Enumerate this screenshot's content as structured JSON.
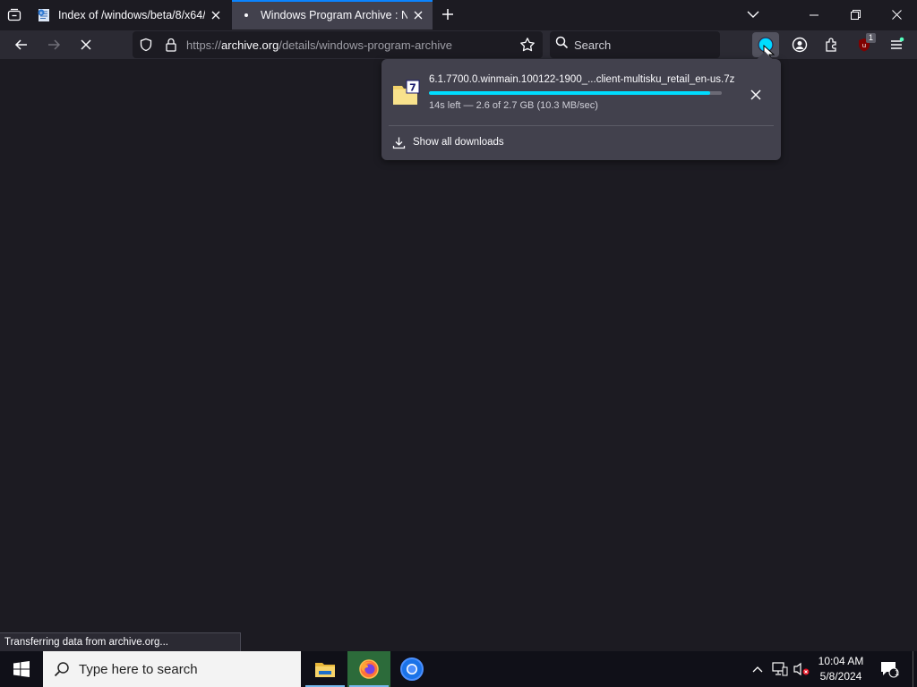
{
  "browser": {
    "tabs": [
      {
        "title": "Index of /windows/beta/8/x64/",
        "active": false
      },
      {
        "title": "Windows Program Archive : Nic",
        "active": true
      }
    ],
    "url": {
      "scheme": "https://",
      "host": "archive.org",
      "path": "/details/windows-program-archive"
    },
    "search_placeholder": "Search",
    "extension_badge": "1",
    "status_text": "Transferring data from archive.org...",
    "colors": {
      "accent": "#0a84ff",
      "progress": "#00ddff",
      "background": "#1c1b22",
      "toolbar": "#2b2a33",
      "panel": "#42414d"
    }
  },
  "downloads_panel": {
    "items": [
      {
        "filename": "6.1.7700.0.winmain.100122-1900_...client-multisku_retail_en-us.7z",
        "status": "14s left — 2.6 of 2.7 GB (10.3 MB/sec)",
        "progress": 0.96,
        "icon": "7z-archive-icon"
      }
    ],
    "show_all_label": "Show all downloads"
  },
  "taskbar": {
    "search_placeholder": "Type here to search",
    "apps": [
      "file-explorer-icon",
      "firefox-icon",
      "chromium-icon"
    ],
    "clock": {
      "time": "10:04 AM",
      "date": "5/8/2024"
    },
    "notification_count": "1"
  }
}
